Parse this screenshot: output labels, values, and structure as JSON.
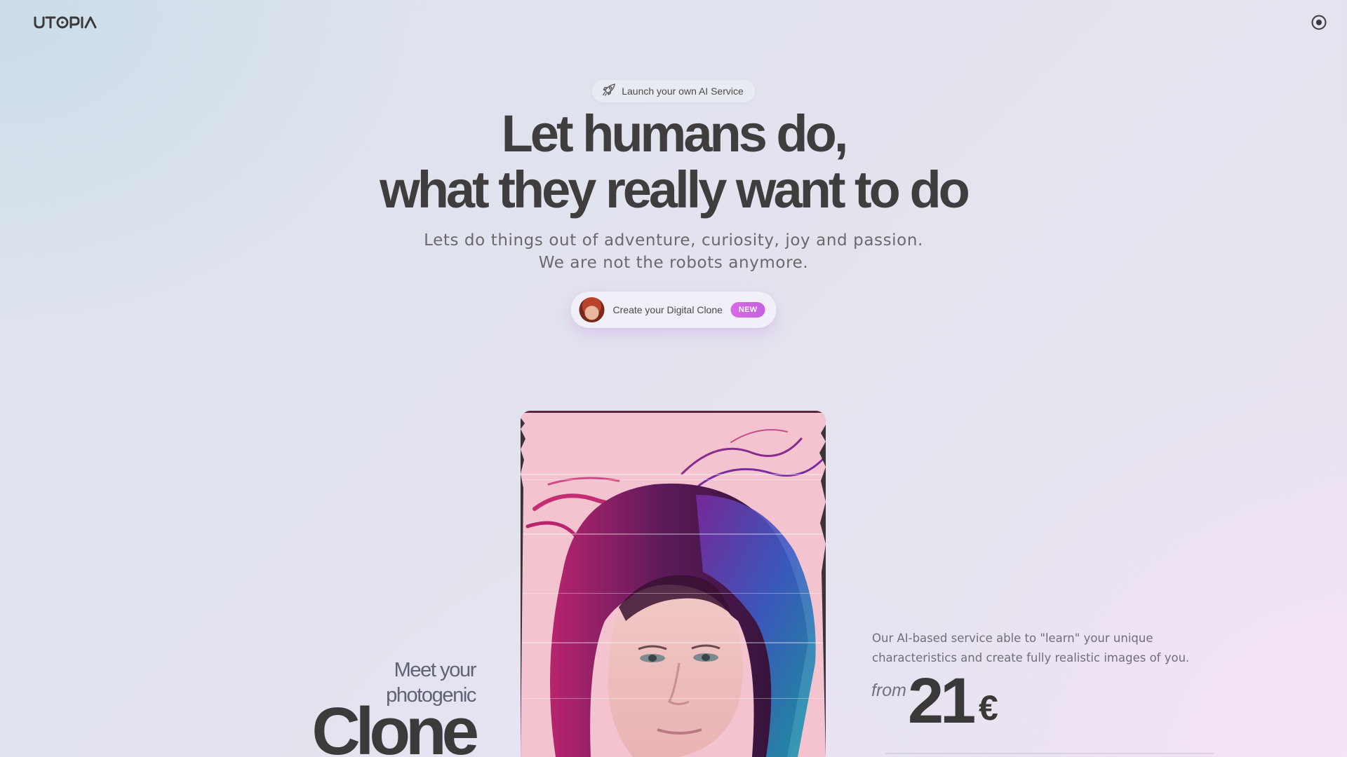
{
  "header": {
    "logo_text": "UTOPIA",
    "logo_icon": "utopia-wordmark",
    "menu_icon": "target-icon"
  },
  "hero": {
    "launch_pill": {
      "icon": "rocket-icon",
      "label": "Launch your own AI Service"
    },
    "headline_line1": "Let humans do,",
    "headline_line2": "what they really want to do",
    "subline_line1": "Lets do things out of adventure, curiosity, joy and passion.",
    "subline_line2": "We are not the robots anymore.",
    "cta": {
      "label": "Create your Digital Clone",
      "badge": "NEW"
    }
  },
  "clone_section": {
    "meet_line1": "Meet your",
    "meet_line2": "photogenic",
    "meet_word": "Clone",
    "description": "Our AI-based service able to \"learn\" your unique characteristics and create fully realistic images of you.",
    "price_prefix": "from",
    "price_value": "21",
    "price_currency": "€"
  },
  "colors": {
    "accent_badge": "#d86ae4",
    "headline": "#3f3d3d",
    "body_text": "#6a6a6a"
  }
}
